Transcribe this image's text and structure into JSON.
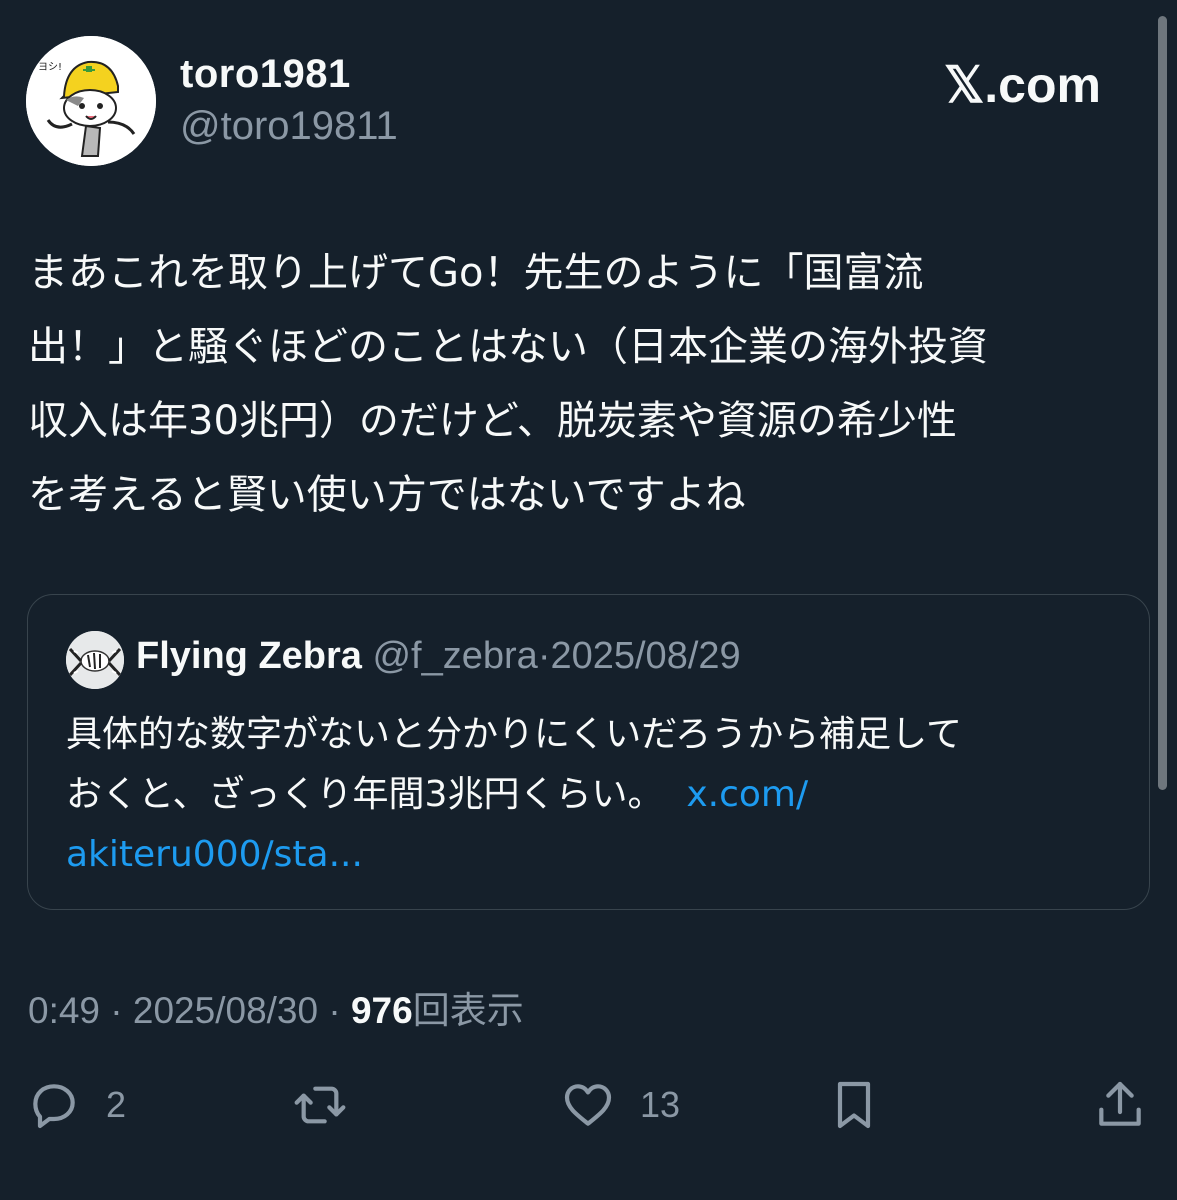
{
  "author": {
    "display_name": "toro1981",
    "handle": "@toro19811",
    "avatar_icon": "hardhat-cat-avatar-icon"
  },
  "brand": {
    "icon": "x-logo-icon",
    "text": "𝕏.com"
  },
  "tweet": {
    "lines": [
      "まあこれを取り上げてGo！先生のように「国富流",
      "出！」と騒ぐほどのことはない（日本企業の海外投資",
      "収入は年30兆円）のだけど、脱炭素や資源の希少性",
      "を考えると賢い使い方ではないですよね"
    ]
  },
  "quote": {
    "avatar_icon": "zebra-avatar-icon",
    "name": "Flying Zebra",
    "handle": "@f_zebra",
    "separator": "·",
    "date": "2025/08/29",
    "line1": "具体的な数字がないと分かりにくいだろうから補足して",
    "line2": "おくと、ざっくり年間3兆円くらい。",
    "link_part1": "x.com/",
    "link_part2": "akiteru000/sta..."
  },
  "meta": {
    "time": "0:49",
    "sep1": "·",
    "date": "2025/08/30",
    "sep2": "·",
    "views_count": "976",
    "views_label": "回表示"
  },
  "actions": {
    "reply_count": "2",
    "like_count": "13"
  },
  "colors": {
    "background": "#15202b",
    "text": "#f7f9f9",
    "secondary": "#8b98a5",
    "link": "#1d9bf0",
    "border": "#38444d"
  }
}
